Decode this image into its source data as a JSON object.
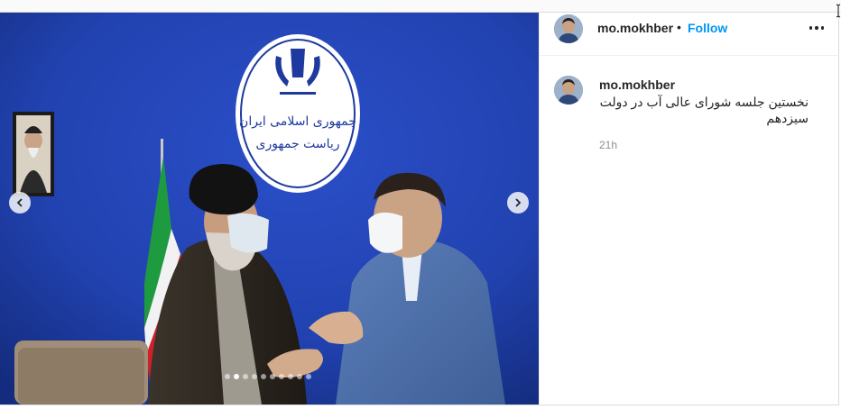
{
  "post": {
    "username": "mo.mokhber",
    "separator": "•",
    "follow_label": "Follow",
    "more_icon": "more-horizontal-icon",
    "caption": {
      "username": "mo.mokhber",
      "text": "نخستین جلسه شورای عالی آب در دولت سیزدهم",
      "time": "21h"
    },
    "carousel": {
      "slide_count": 10,
      "active_index": 1,
      "prev_icon": "chevron-left-icon",
      "next_icon": "chevron-right-icon"
    }
  },
  "photo": {
    "emblem_text_line1": "جمهوری اسلامی ایران",
    "emblem_text_line2": "ریاست جمهوری"
  },
  "colors": {
    "follow": "#0095f6",
    "text": "#262626",
    "muted": "#8e8e8e",
    "backdrop": "#1f3a9e"
  }
}
